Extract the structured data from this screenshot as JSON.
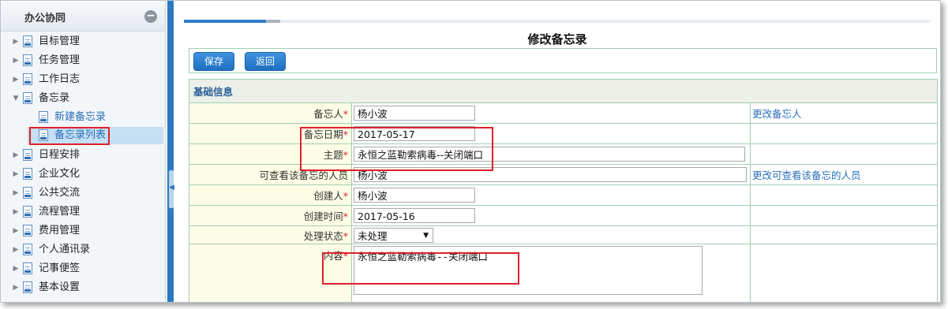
{
  "sidebar": {
    "title": "办公协同",
    "collapse_icon": "minus-circle-icon",
    "items": [
      {
        "label": "目标管理",
        "expanded": false
      },
      {
        "label": "任务管理",
        "expanded": false
      },
      {
        "label": "工作日志",
        "expanded": false
      },
      {
        "label": "备忘录",
        "expanded": true,
        "children": [
          {
            "label": "新建备忘录"
          },
          {
            "label": "备忘录列表",
            "selected": true
          }
        ]
      },
      {
        "label": "日程安排",
        "expanded": false
      },
      {
        "label": "企业文化",
        "expanded": false
      },
      {
        "label": "公共交流",
        "expanded": false
      },
      {
        "label": "流程管理",
        "expanded": false
      },
      {
        "label": "费用管理",
        "expanded": false
      },
      {
        "label": "个人通讯录",
        "expanded": false
      },
      {
        "label": "记事便签",
        "expanded": false
      },
      {
        "label": "基本设置",
        "expanded": false
      }
    ]
  },
  "main": {
    "title": "修改备忘录",
    "toolbar": {
      "save_label": "保存",
      "back_label": "返回"
    },
    "section_title": "基础信息",
    "required_mark": "*",
    "fields": {
      "owner": {
        "label": "备忘人",
        "value": "杨小波",
        "action": "更改备忘人"
      },
      "date": {
        "label": "备忘日期",
        "value": "2017-05-17"
      },
      "subject": {
        "label": "主题",
        "value": "永恒之蓝勒索病毒--关闭端口"
      },
      "viewers": {
        "label": "可查看该备忘的人员",
        "value": "杨小波",
        "action": "更改可查看该备忘的人员"
      },
      "creator": {
        "label": "创建人",
        "value": "杨小波"
      },
      "created_time": {
        "label": "创建时间",
        "value": "2017-05-16"
      },
      "status": {
        "label": "处理状态",
        "value": "未处理"
      },
      "content": {
        "label": "内容",
        "value": "永恒之蓝勒索病毒--关闭端口"
      }
    }
  },
  "colors": {
    "accent": "#2e7dc9",
    "splitter": "#2b79c2",
    "highlight_box": "#e0202a",
    "table_border": "#9fcfb3",
    "label_bg": "#fdfde6"
  }
}
